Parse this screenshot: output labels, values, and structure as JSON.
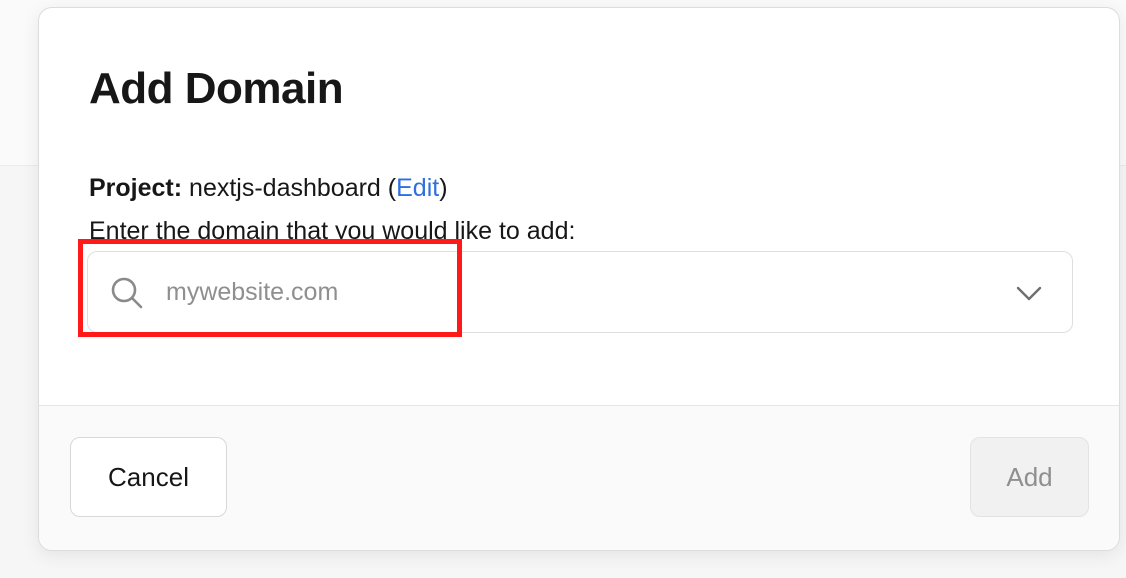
{
  "dialog": {
    "title": "Add Domain",
    "project_label": "Project:",
    "project_name": " nextjs-dashboard (",
    "edit_link": "Edit",
    "project_suffix": ")",
    "instruction": "Enter the domain that you would like to add:"
  },
  "domain_field": {
    "value": "",
    "placeholder": "mywebsite.com",
    "icon": "search-icon",
    "dropdown_icon": "chevron-down-icon"
  },
  "footer": {
    "cancel_label": "Cancel",
    "add_label": "Add"
  },
  "colors": {
    "link": "#2f6fe0",
    "highlight": "#ff1a1a",
    "text": "#171717",
    "disabled_text": "#8f8f8f"
  }
}
